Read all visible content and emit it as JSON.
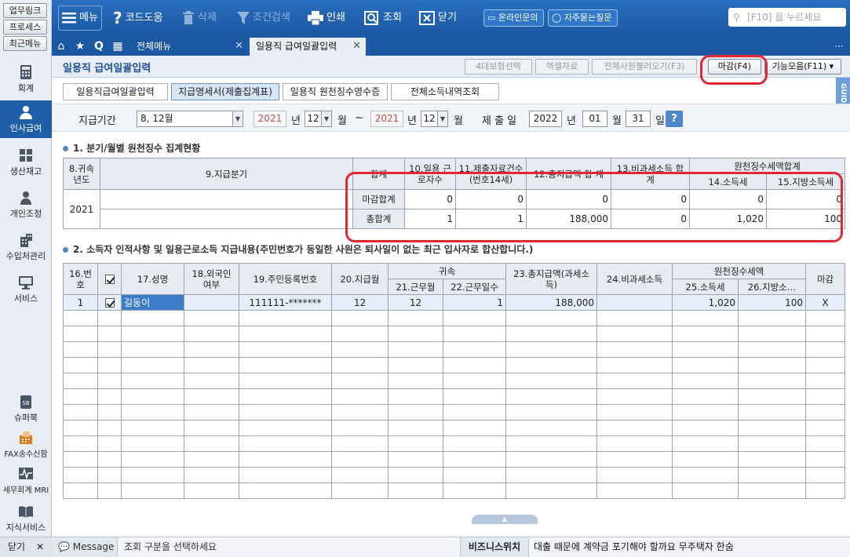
{
  "sidebar": {
    "quick": [
      "업무링크",
      "프로세스",
      "최근메뉴"
    ],
    "items": [
      {
        "label": "회계",
        "icon": "calculator-icon"
      },
      {
        "label": "인사급여",
        "icon": "person-icon",
        "active": true
      },
      {
        "label": "생산재고",
        "icon": "grid-icon"
      },
      {
        "label": "개인조정",
        "icon": "user-icon"
      },
      {
        "label": "수입처관리",
        "icon": "building-icon"
      },
      {
        "label": "서비스",
        "icon": "monitor-icon"
      },
      {
        "label": "슈퍼북",
        "icon": "superbook-icon"
      },
      {
        "label": "FAX송수신함",
        "icon": "fax-icon"
      },
      {
        "label": "세무회계 MRI",
        "icon": "mri-icon"
      },
      {
        "label": "지식서비스",
        "icon": "book-icon"
      }
    ],
    "close": "닫기"
  },
  "toolbar": {
    "menu": "메뉴",
    "code_help": "코드도움",
    "delete": "삭제",
    "filter": "조건검색",
    "print": "인쇄",
    "search": "조회",
    "close": "닫기",
    "online_inquiry": "온라인문의",
    "faq": "자주묻는질문",
    "search_placeholder": "[F10] 을 누르세요"
  },
  "tabs": {
    "all_menu": "전체메뉴",
    "current": "일용직 급여일괄입력"
  },
  "page": {
    "title": "일용직 급여일괄입력",
    "actions": {
      "insurance": "4대보험선택",
      "excel": "엑셀자료",
      "load_all": "전체사원불러오기(F3)",
      "close_f4": "마감(F4)",
      "functions": "기능모음(F11)"
    },
    "subtabs": [
      "일용직급여일괄입력",
      "지급명세서(제출집계표)",
      "일용직 원천징수영수증",
      "전체소득내역조회"
    ],
    "guide": "GUIDE"
  },
  "filter": {
    "period_label": "지급기간",
    "period_value": "8, 12월",
    "from_year": "2021",
    "year_unit": "년",
    "from_month": "12",
    "month_unit": "월",
    "tilde": "~",
    "to_year": "2021",
    "to_month": "12",
    "submit_label": "제 출 일",
    "submit_year": "2022",
    "submit_month": "01",
    "submit_day": "31",
    "day_unit": "일"
  },
  "section1": {
    "title": "1. 분기/월별 원천징수 집계현황",
    "headers": {
      "year": "8.귀속 년도",
      "period": "9.지급분기",
      "total": "합계",
      "workers": "10.일용 근로자수",
      "submissions": "11.제출자료건수(번호14세)",
      "pay": "12.총지급액 합 계",
      "nontax": "13.비과세소득 합 계",
      "withholding": "원천징수세액합계",
      "income_tax": "14.소득세",
      "local_tax": "15.지방소득세"
    },
    "year_value": "2021",
    "rows": [
      {
        "label": "마감합계",
        "workers": "0",
        "submissions": "0",
        "pay": "0",
        "nontax": "0",
        "income_tax": "0",
        "local_tax": "0"
      },
      {
        "label": "총합계",
        "workers": "1",
        "submissions": "1",
        "pay": "188,000",
        "nontax": "0",
        "income_tax": "1,020",
        "local_tax": "100"
      }
    ]
  },
  "section2": {
    "title": "2. 소득자 인적사항 및 일용근로소득 지급내용(주민번호가 동일한 사원은 퇴사일이 없는 최근 입사자로 합산합니다.)",
    "headers": {
      "no": "16.번호",
      "name": "17.성명",
      "foreign": "18.외국인 여부",
      "rrn": "19.주민등록번호",
      "pay_month": "20.지급월",
      "attribution": "귀속",
      "work_month": "21.근무월",
      "work_days": "22.근무일수",
      "total_pay": "23.총지급액(과세소득)",
      "nontax": "24.비과세소득",
      "withholding": "원천징수세액",
      "income_tax": "25.소득세",
      "local_tax": "26.지방소…",
      "closed": "마감"
    },
    "rows": [
      {
        "no": "1",
        "name": "길동이",
        "foreign": "",
        "rrn": "111111-*******",
        "pay_month": "12",
        "work_month": "12",
        "work_days": "1",
        "total_pay": "188,000",
        "nontax": "",
        "income_tax": "1,020",
        "local_tax": "100",
        "closed": "X"
      }
    ]
  },
  "status": {
    "message_label": "Message",
    "message": "조회 구분을 선택하세요",
    "business_label": "비즈니스위치",
    "business_text": "대출 때문에 계약금 포기해야 할까요 무주택자 한숨"
  },
  "colors": {
    "brand_blue": "#1f5fa8",
    "highlight_red": "#e32632",
    "header_bg": "#e6ebf2"
  }
}
